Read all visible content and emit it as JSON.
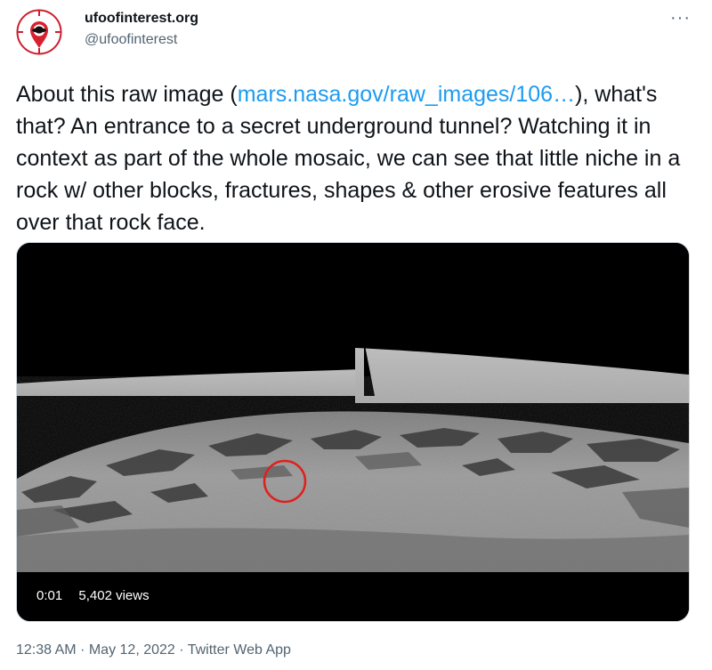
{
  "account": {
    "name": "ufoofinterest.org",
    "handle": "@ufoofinterest"
  },
  "tweet": {
    "text_before": "About this raw image (",
    "link": "mars.nasa.gov/raw_images/106…",
    "text_after": "), what's that? An entrance to a secret underground tunnel? Watching it in context as part of the whole mosaic, we can see that little niche in a rock w/ other blocks, fractures, shapes & other erosive features all over that rock face."
  },
  "video": {
    "time": "0:01",
    "views": "5,402 views"
  },
  "meta": {
    "time": "12:38 AM",
    "sep1": "·",
    "date": "May 12, 2022",
    "sep2": "·",
    "source": "Twitter Web App"
  },
  "icons": {
    "more": "more-icon",
    "avatar": "ufo-logo-icon"
  },
  "colors": {
    "link": "#1d9bf0",
    "secondary_text": "#536471",
    "avatar_ring": "#c8102e",
    "annotation_circle": "#e0201c"
  }
}
